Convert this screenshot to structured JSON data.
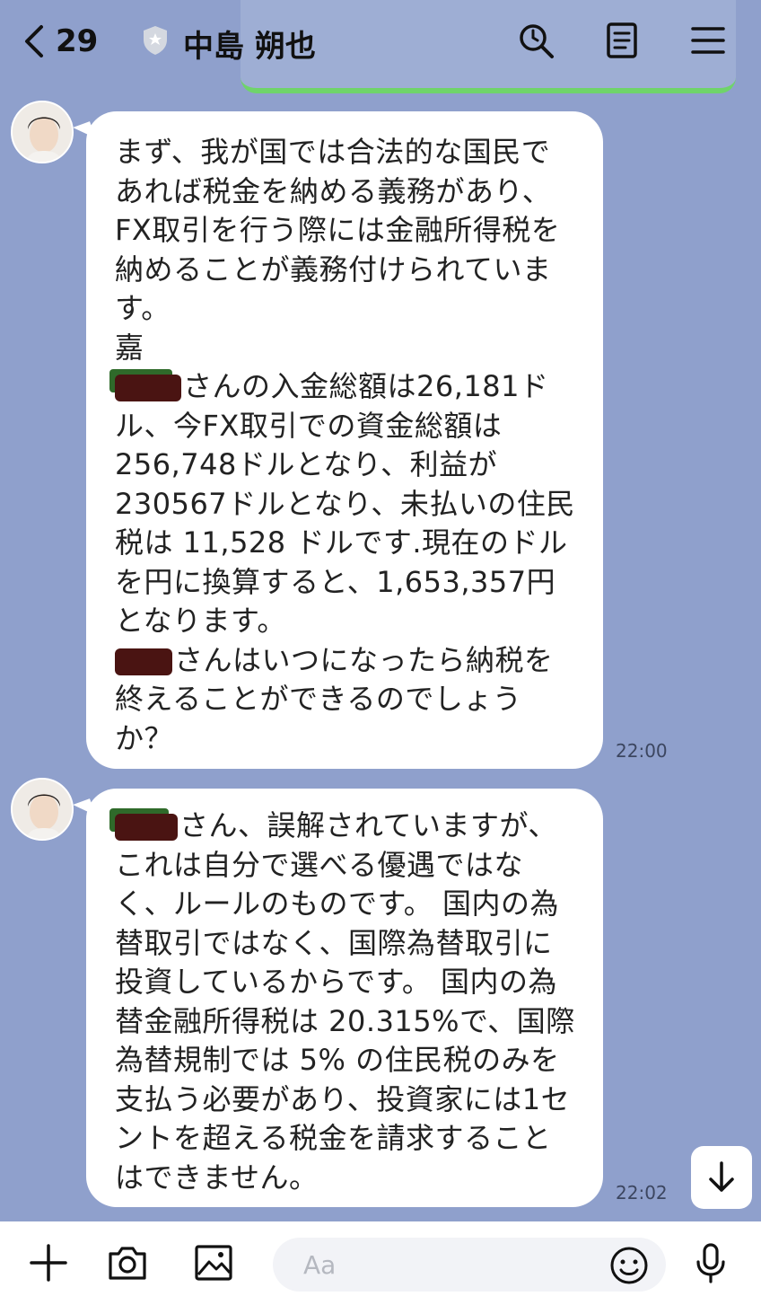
{
  "header": {
    "back_count": "29",
    "contact_name": "中島 朔也"
  },
  "messages": [
    {
      "pre": "まず、我が国では合法的な国民であれば税金を納める義務があり、FX取引を行う際には金融所得税を納めることが義務付けられています。\n嘉",
      "line_after_redact": "さんの入金総額は26,181ドル、今FX取引での資金総額は256,748ドルとなり、利益が230567ドルとなり、未払いの住民税は 11,528 ドルです.現在のドルを円に換算すると、1,653,357円となります。",
      "line_after_redact2": "さんはいつになったら納税を終えることができるのでしょうか？",
      "time": "22:00"
    },
    {
      "line_after_redact": "さん、誤解されていますが、これは自分で選べる優遇ではなく、ルールのものです。 国内の為替取引ではなく、国際為替取引に投資しているからです。 国内の為替金融所得税は 20.315%で、国際為替規制では 5% の住民税のみを支払う必要があり、投資家には1セントを超える税金を請求することはできません。",
      "time": "22:02"
    }
  ],
  "input": {
    "placeholder": "Aa"
  }
}
